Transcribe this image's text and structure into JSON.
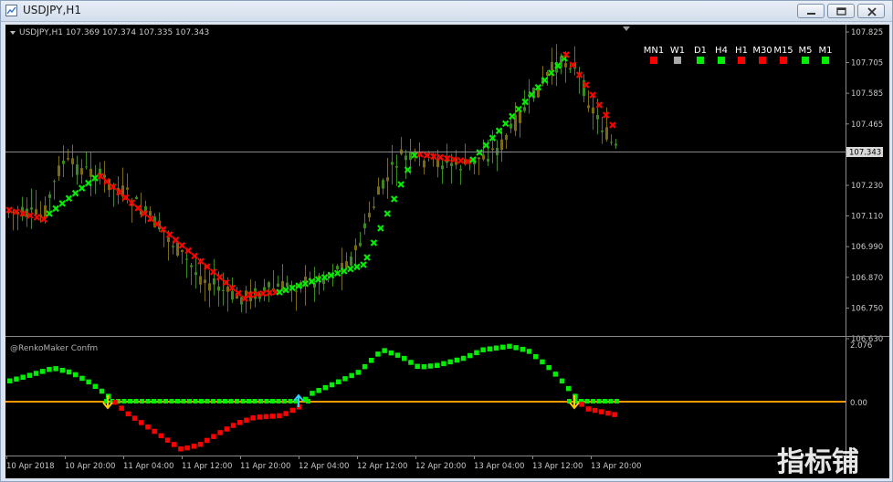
{
  "window": {
    "title": "USDJPY,H1"
  },
  "main_panel": {
    "info": "USDJPY,H1  107.369 107.374 107.335 107.343",
    "price_ticks": [
      "107.825",
      "107.705",
      "107.585",
      "107.465",
      "107.343",
      "107.230",
      "107.110",
      "106.990",
      "106.870",
      "106.750",
      "106.630"
    ],
    "current_price": "107.343"
  },
  "mtf_table": {
    "labels": [
      "MN1",
      "W1",
      "D1",
      "H4",
      "H1",
      "M30",
      "M15",
      "M5",
      "M1"
    ],
    "colors": [
      "#ff0000",
      "#aaaaaa",
      "#00ee00",
      "#00ee00",
      "#ff0000",
      "#ff0000",
      "#ff0000",
      "#00ee00",
      "#00ee00"
    ]
  },
  "sub_panel": {
    "title": "@RenkoMaker Confm",
    "y_ticks": [
      "2.076",
      "0.00"
    ]
  },
  "time_axis": [
    "10 Apr 2018",
    "10 Apr 20:00",
    "11 Apr 04:00",
    "11 Apr 12:00",
    "11 Apr 20:00",
    "12 Apr 04:00",
    "12 Apr 12:00",
    "12 Apr 20:00",
    "13 Apr 04:00",
    "13 Apr 12:00",
    "13 Apr 20:00"
  ],
  "watermark": "指标铺",
  "colors": {
    "up": "#00ee00",
    "down": "#ff0000",
    "zero_line": "#ff9900",
    "signal_down": "#ffcc00",
    "signal_up": "#33ccff"
  }
}
